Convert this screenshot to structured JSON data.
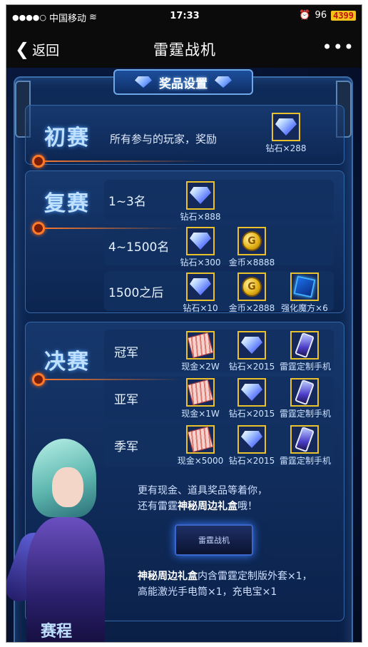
{
  "statusbar": {
    "carrier": "中国移动",
    "time": "17:33",
    "battery": "96",
    "watermark": "4399"
  },
  "navbar": {
    "back_label": "返回",
    "title": "雷霆战机",
    "more_label": "•••"
  },
  "header": {
    "title": "奖品设置"
  },
  "sections": {
    "prelim": {
      "label": "初赛",
      "desc": "所有参与的玩家，奖励",
      "prize_caption": "钻石×288"
    },
    "semifinal": {
      "label": "复赛",
      "rows": [
        {
          "label": "1~3名",
          "prizes": [
            "钻石×888"
          ]
        },
        {
          "label": "4~1500名",
          "prizes": [
            "钻石×300",
            "金币×8888"
          ]
        },
        {
          "label": "1500之后",
          "prizes": [
            "钻石×10",
            "金币×2888",
            "强化魔方×6"
          ]
        }
      ]
    },
    "final": {
      "label": "决赛",
      "rows": [
        {
          "label": "冠军",
          "prizes": [
            "现金×2W",
            "钻石×2015",
            "雷霆定制手机"
          ]
        },
        {
          "label": "亚军",
          "prizes": [
            "现金×1W",
            "钻石×2015",
            "雷霆定制手机"
          ]
        },
        {
          "label": "季军",
          "prizes": [
            "现金×5000",
            "钻石×2015",
            "雷霆定制手机"
          ]
        }
      ]
    }
  },
  "bonus": {
    "line1": "更有现金、道具奖品等着你，",
    "line2_pre": "还有雷霆",
    "line2_hl": "神秘周边礼盒",
    "line2_post": "哦！",
    "box_text": "雷霆战机",
    "desc_hl": "神秘周边礼盒",
    "desc_line1": "内含雷霆定制版外套×1，",
    "desc_line2": "高能激光手电筒×1，充电宝×1"
  },
  "bottom_label": "赛程"
}
